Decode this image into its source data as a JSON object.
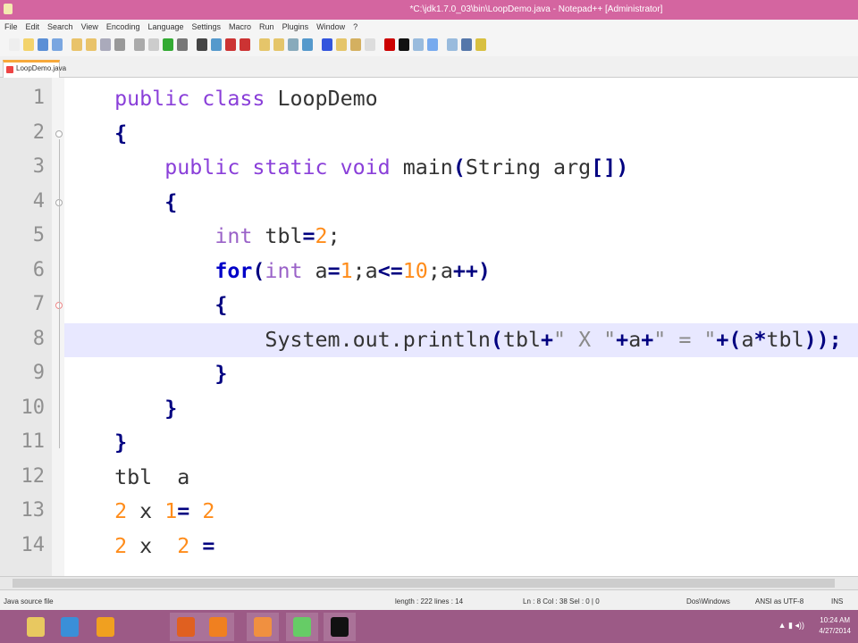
{
  "window": {
    "title": "*C:\\jdk1.7.0_03\\bin\\LoopDemo.java - Notepad++ [Administrator]"
  },
  "menu": [
    "File",
    "Edit",
    "Search",
    "View",
    "Encoding",
    "Language",
    "Settings",
    "Macro",
    "Run",
    "Plugins",
    "Window",
    "?"
  ],
  "tab": {
    "label": "LoopDemo.java"
  },
  "editor": {
    "current_line": 8,
    "lines": [
      [
        [
          "    ",
          "plain"
        ],
        [
          "public",
          "kw"
        ],
        [
          " ",
          "plain"
        ],
        [
          "class",
          "kw"
        ],
        [
          " LoopDemo",
          "plain"
        ]
      ],
      [
        [
          "    ",
          "plain"
        ],
        [
          "{",
          "op"
        ]
      ],
      [
        [
          "        ",
          "plain"
        ],
        [
          "public",
          "kw"
        ],
        [
          " ",
          "plain"
        ],
        [
          "static",
          "kw"
        ],
        [
          " ",
          "plain"
        ],
        [
          "void",
          "kw"
        ],
        [
          " main",
          "plain"
        ],
        [
          "(",
          "op"
        ],
        [
          "String arg",
          "plain"
        ],
        [
          "[])",
          "op"
        ]
      ],
      [
        [
          "        ",
          "plain"
        ],
        [
          "{",
          "op"
        ]
      ],
      [
        [
          "            ",
          "plain"
        ],
        [
          "int",
          "type"
        ],
        [
          " tbl",
          "plain"
        ],
        [
          "=",
          "op"
        ],
        [
          "2",
          "num"
        ],
        [
          ";",
          "plain"
        ]
      ],
      [
        [
          "            ",
          "plain"
        ],
        [
          "for",
          "kw2"
        ],
        [
          "(",
          "op"
        ],
        [
          "int",
          "type"
        ],
        [
          " a",
          "plain"
        ],
        [
          "=",
          "op"
        ],
        [
          "1",
          "num"
        ],
        [
          ";a",
          "plain"
        ],
        [
          "<=",
          "op"
        ],
        [
          "10",
          "num"
        ],
        [
          ";a",
          "plain"
        ],
        [
          "++)",
          "op"
        ]
      ],
      [
        [
          "            ",
          "plain"
        ],
        [
          "{",
          "op"
        ]
      ],
      [
        [
          "                ",
          "plain"
        ],
        [
          "System.out.println",
          "plain"
        ],
        [
          "(",
          "op"
        ],
        [
          "tbl",
          "plain"
        ],
        [
          "+",
          "op"
        ],
        [
          "\" X \"",
          "str"
        ],
        [
          "+",
          "op"
        ],
        [
          "a",
          "plain"
        ],
        [
          "+",
          "op"
        ],
        [
          "\" = \"",
          "str"
        ],
        [
          "+(",
          "op"
        ],
        [
          "a",
          "plain"
        ],
        [
          "*",
          "op"
        ],
        [
          "tbl",
          "plain"
        ],
        [
          "));",
          "op"
        ]
      ],
      [
        [
          "            ",
          "plain"
        ],
        [
          "}",
          "op"
        ]
      ],
      [
        [
          "        ",
          "plain"
        ],
        [
          "}",
          "op"
        ]
      ],
      [
        [
          "    ",
          "plain"
        ],
        [
          "}",
          "op"
        ]
      ],
      [
        [
          "    ",
          "plain"
        ],
        [
          "tbl  a",
          "plain"
        ]
      ],
      [
        [
          "    ",
          "plain"
        ],
        [
          "2",
          "num"
        ],
        [
          " x ",
          "plain"
        ],
        [
          "1",
          "num"
        ],
        [
          "=",
          "op"
        ],
        [
          " ",
          "plain"
        ],
        [
          "2",
          "num"
        ]
      ],
      [
        [
          "    ",
          "plain"
        ],
        [
          "2",
          "num"
        ],
        [
          " x  ",
          "plain"
        ],
        [
          "2",
          "num"
        ],
        [
          " ",
          "plain"
        ],
        [
          "=",
          "op"
        ]
      ]
    ]
  },
  "status": {
    "file_type": "Java source file",
    "length": "length : 222   lines : 14",
    "position": "Ln : 8   Col : 38   Sel : 0 | 0",
    "eol": "Dos\\Windows",
    "encoding": "ANSI as UTF-8",
    "mode": "INS"
  },
  "taskbar": {
    "apps": [
      "file-explorer",
      "internet-explorer",
      "mcafee",
      "firefox",
      "vlc",
      "xampp",
      "notepad-plus-plus",
      "command-prompt"
    ],
    "time": "10:24 AM",
    "date": "4/27/2014"
  }
}
